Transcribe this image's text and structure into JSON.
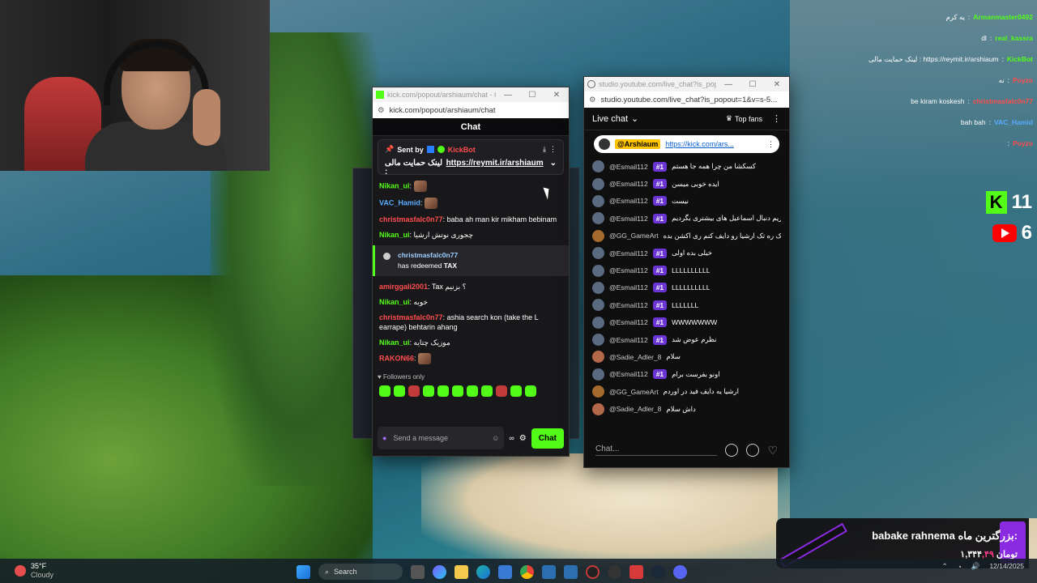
{
  "kick": {
    "window_title": "kick.com/popout/arshiaum/chat - G...",
    "url": "kick.com/popout/arshiaum/chat",
    "chat_header": "Chat",
    "pinned": {
      "sent_by_label": "Sent by",
      "sender": "KickBot",
      "text": "لینک حمایت مالی :",
      "link": "https://reymit.ir/arshiaum"
    },
    "messages": [
      {
        "user": "Nikan_ui",
        "color": "#53fc18",
        "text": ""
      },
      {
        "user": "VAC_Hamid",
        "color": "#5aa9ff",
        "text": ""
      },
      {
        "user": "christmasfalc0n77",
        "color": "#ff4d4d",
        "text": "baba ah man kir mikham bebinam"
      },
      {
        "user": "Nikan_ui",
        "color": "#53fc18",
        "text": "چجوری نوتش ارشیا"
      }
    ],
    "redeem": {
      "user": "christmasfalc0n77",
      "text": "has redeemed",
      "reward": "TAX"
    },
    "messages2": [
      {
        "user": "amirggali2001",
        "color": "#ff4d4d",
        "text": "Tax ؟ بزنیم"
      },
      {
        "user": "Nikan_ui",
        "color": "#53fc18",
        "text": "خوبه"
      },
      {
        "user": "christmasfalc0n77",
        "color": "#ff4d4d",
        "text": "ashia search kon (take the L earrape) behtarin ahang"
      },
      {
        "user": "Nikan_ui",
        "color": "#53fc18",
        "text": "موزیک چتایه"
      },
      {
        "user": "RAKON66",
        "color": "#ff4d4d",
        "text": ""
      }
    ],
    "followers_only": "Followers only",
    "input_placeholder": "Send a message",
    "chat_button": "Chat"
  },
  "youtube": {
    "window_title": "studio.youtube.com/live_chat?is_popou...",
    "url": "studio.youtube.com/live_chat?is_popout=1&v=s-5...",
    "header_label": "Live chat",
    "top_fans": "Top fans",
    "pinned": {
      "mention": "@Arshiaum",
      "link": "https://kick.com/ars..."
    },
    "messages": [
      {
        "user": "@Esmail112",
        "badge": "#1",
        "text": "کسکشا من چرا همه جا هستم",
        "av": "es"
      },
      {
        "user": "@Esmail112",
        "badge": "#1",
        "text": "ایده خوبی میسن",
        "av": "es"
      },
      {
        "user": "@Esmail112",
        "badge": "#1",
        "text": "نیست",
        "av": "es"
      },
      {
        "user": "@Esmail112",
        "badge": "#1",
        "text": "بریم دنبال اسماعیل های بیشتری بگردیم",
        "av": "es"
      },
      {
        "user": "@GG_GameArt",
        "badge": "",
        "text": "چی میشه من تو یک ره تک ارشیا رو دایف کنم ری اکشن بده",
        "av": "gg"
      },
      {
        "user": "@Esmail112",
        "badge": "#1",
        "text": "خیلی بده اولی",
        "av": "es"
      },
      {
        "user": "@Esmail112",
        "badge": "#1",
        "text": "LLLLLLLLLL",
        "av": "es"
      },
      {
        "user": "@Esmail112",
        "badge": "#1",
        "text": "LLLLLLLLLL",
        "av": "es"
      },
      {
        "user": "@Esmail112",
        "badge": "#1",
        "text": "LLLLLLL",
        "av": "es"
      },
      {
        "user": "@Esmail112",
        "badge": "#1",
        "text": "WWWWWWW",
        "av": "es"
      },
      {
        "user": "@Esmail112",
        "badge": "#1",
        "text": "نظرم عوض شد",
        "av": "es"
      },
      {
        "user": "@Sadie_Adler_8",
        "badge": "",
        "text": "سلام",
        "av": "sa"
      },
      {
        "user": "@Esmail112",
        "badge": "#1",
        "text": "اونو بفرست برام",
        "av": "es"
      },
      {
        "user": "@GG_GameArt",
        "badge": "",
        "text": "ارشیا یه دایف فید در اوردم",
        "av": "gg"
      },
      {
        "user": "@Sadie_Adler_8",
        "badge": "",
        "text": "داش سلام",
        "av": "sa"
      }
    ],
    "input_placeholder": "Chat..."
  },
  "overlay_chat": [
    {
      "user": "Armanmaster0492",
      "color": "#53fc18",
      "text": "یه کرم"
    },
    {
      "user": "real_kassra",
      "color": "#53fc18",
      "text": "dl"
    },
    {
      "user": "KickBot",
      "color": "#53fc18",
      "text": "لینک حمایت مالی : https://reymit.ir/arshiaum"
    },
    {
      "user": "Poyzo",
      "color": "#ff4d4d",
      "text": "نه"
    },
    {
      "user": "christmasfalc0n77",
      "color": "#ff4d4d",
      "text": "be kiram koskesh"
    },
    {
      "user": "VAC_Hamid",
      "color": "#5aa9ff",
      "text": "bah bah"
    },
    {
      "user": "Poyzo",
      "color": "#ff4d4d",
      "text": ""
    }
  ],
  "viewers": {
    "kick": "11",
    "youtube": "6"
  },
  "donation": {
    "label": "بزرگترین ماه:",
    "name": "babake rahnema",
    "amount_prefix": "۱,۳۴۴",
    "amount_suffix": ",۴۹",
    "currency": "تومان"
  },
  "taskbar": {
    "temperature": "35°F",
    "weather": "Cloudy",
    "search_placeholder": "Search",
    "time": "",
    "date": "12/14/2025"
  }
}
